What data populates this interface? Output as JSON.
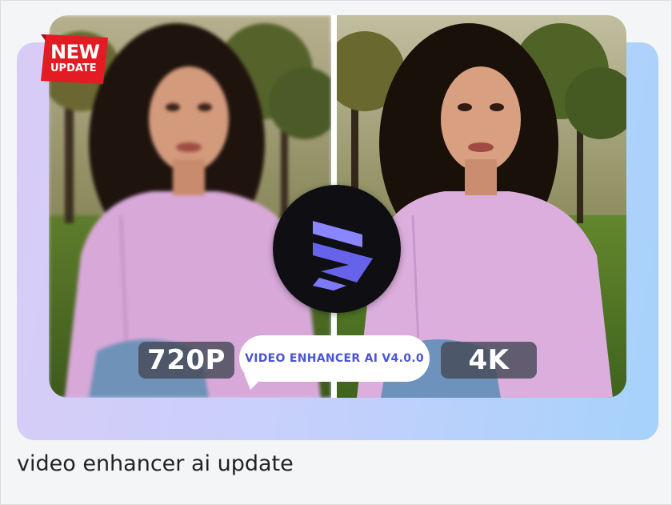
{
  "badge": {
    "new_label": "NEW",
    "update_label": "UPDATE",
    "color": "#e31b23"
  },
  "comparison": {
    "left_resolution": "720P",
    "right_resolution": "4K",
    "version_label": "VIDEO ENHANCER AI V4.0.0"
  },
  "logo": {
    "icon": "video-enhancer-logo-icon",
    "accent": "#6f6ef5"
  },
  "caption": "video enhancer ai update",
  "colors": {
    "frame_gradient_start": "#d9ccf7",
    "frame_gradient_end": "#a6d2fb",
    "version_text": "#4a55d6"
  }
}
